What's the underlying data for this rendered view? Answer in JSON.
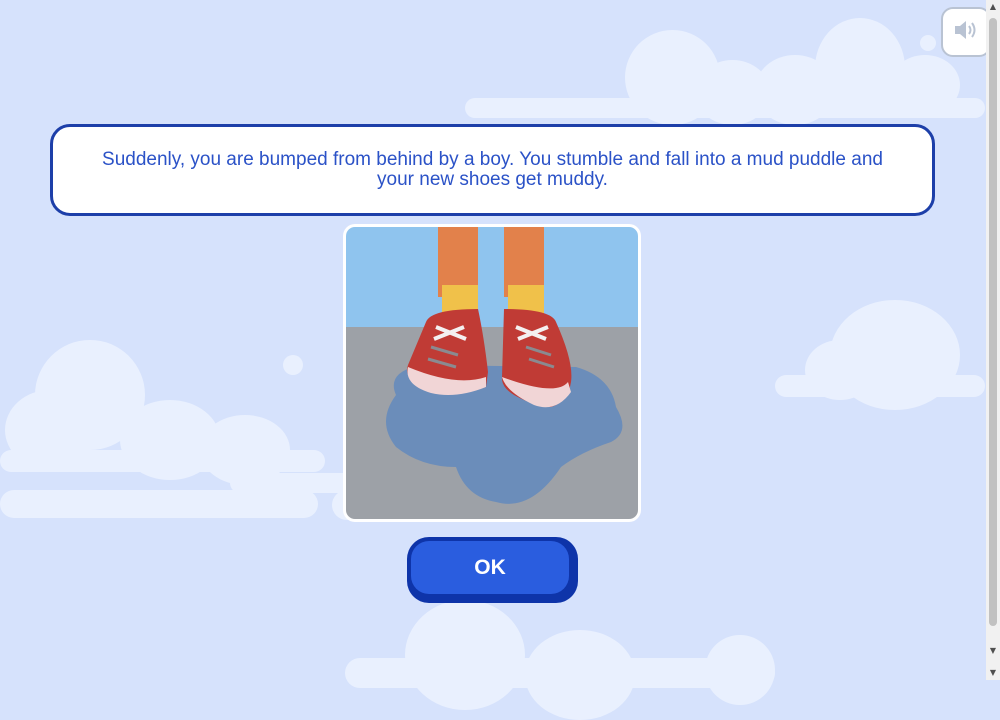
{
  "dialog": {
    "message": "Suddenly, you are bumped from behind by a boy. You stumble and fall into a mud puddle and your new shoes get muddy."
  },
  "scene": {
    "description_icon": "muddy-red-sneakers-illustration"
  },
  "buttons": {
    "ok_label": "OK"
  },
  "controls": {
    "sound_icon": "speaker-icon"
  },
  "colors": {
    "background": "#d6e2fc",
    "dialog_border": "#1d3fa9",
    "dialog_text": "#2b52c7",
    "button_face": "#2a5ddf",
    "button_shadow": "#0e34a9"
  }
}
